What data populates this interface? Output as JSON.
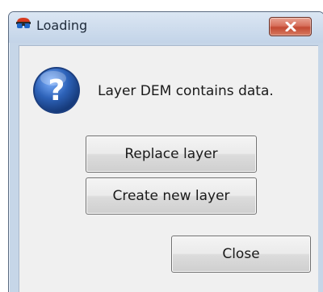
{
  "dialog": {
    "title": "Loading",
    "message": "Layer DEM contains data.",
    "buttons": {
      "replace_label": "Replace layer",
      "create_label": "Create new layer",
      "close_label": "Close"
    }
  },
  "icons": {
    "app": "app-glasses-icon",
    "question": "question-icon",
    "titlebar_close": "close-icon"
  },
  "colors": {
    "titlebar_close_red": "#c34a33",
    "question_blue": "#2d62b8",
    "dialog_background": "#f0f0f0"
  }
}
